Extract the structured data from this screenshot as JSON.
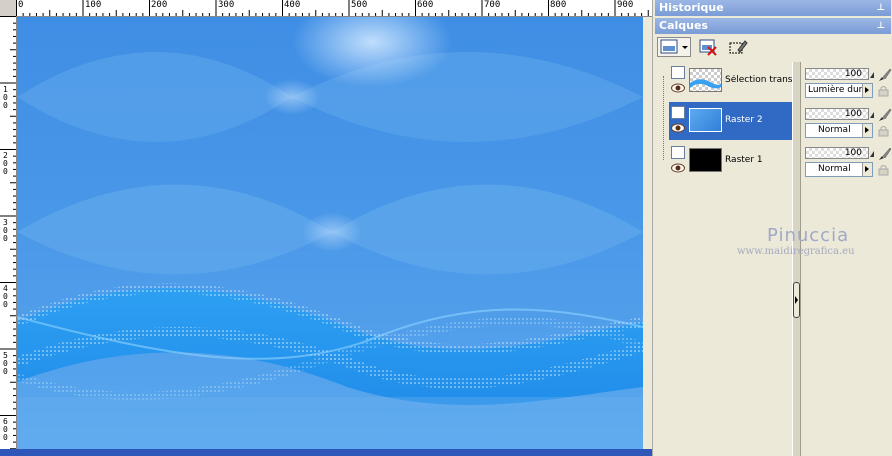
{
  "rulers": {
    "top_labels": [
      "0",
      "100",
      "200",
      "300",
      "400",
      "500",
      "600",
      "700",
      "800",
      "900"
    ],
    "left_labels": [
      [
        "1",
        "0",
        "0"
      ],
      [
        "2",
        "0",
        "0"
      ],
      [
        "3",
        "0",
        "0"
      ],
      [
        "4",
        "0",
        "0"
      ],
      [
        "5",
        "0",
        "0"
      ],
      [
        "6",
        "0",
        "0"
      ]
    ]
  },
  "palettes": {
    "history_title": "Historique",
    "layers_title": "Calques",
    "pin_glyph": "⊥"
  },
  "layers": [
    {
      "name": "Sélection transformée",
      "opacity": "100",
      "blend": "Lumière dure",
      "selected": false,
      "thumb": "wave-transparent"
    },
    {
      "name": "Raster 2",
      "opacity": "100",
      "blend": "Normal",
      "selected": true,
      "thumb": "blue-gradient"
    },
    {
      "name": "Raster 1",
      "opacity": "100",
      "blend": "Normal",
      "selected": false,
      "thumb": "black-fill"
    }
  ],
  "toolbar": {
    "icons": [
      "new-layer-icon",
      "delete-layer-icon",
      "edit-selection-icon"
    ]
  },
  "watermark": {
    "title": "Pinuccia",
    "url": "www.maidiregrafica.eu"
  },
  "colors": {
    "selection": "#316ac5",
    "palette_bg": "#ece9d8",
    "title_bar": "#7a9bd6",
    "canvas_blue": "#3a8fe6"
  }
}
